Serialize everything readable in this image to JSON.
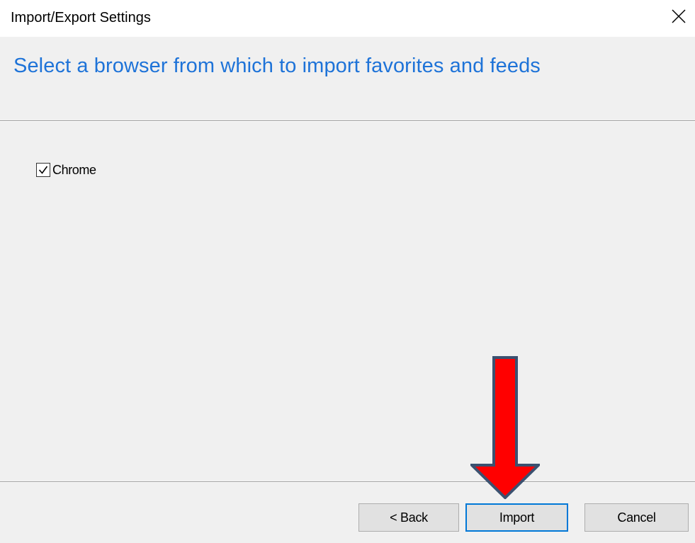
{
  "window": {
    "title": "Import/Export Settings",
    "close_icon": "close-icon"
  },
  "header": {
    "heading": "Select a browser from which to import favorites and feeds"
  },
  "browsers": [
    {
      "label": "Chrome",
      "checked": true
    }
  ],
  "buttons": {
    "back_label": "< Back",
    "import_label": "Import",
    "cancel_label": "Cancel"
  },
  "annotation": {
    "icon": "down-arrow-icon",
    "color": "#ff0000",
    "outline_color": "#3b5170"
  },
  "colors": {
    "heading": "#1e73d8",
    "focus_border": "#0078d7",
    "button_bg": "#e1e1e1",
    "dialog_bg": "#f0f0f0"
  }
}
